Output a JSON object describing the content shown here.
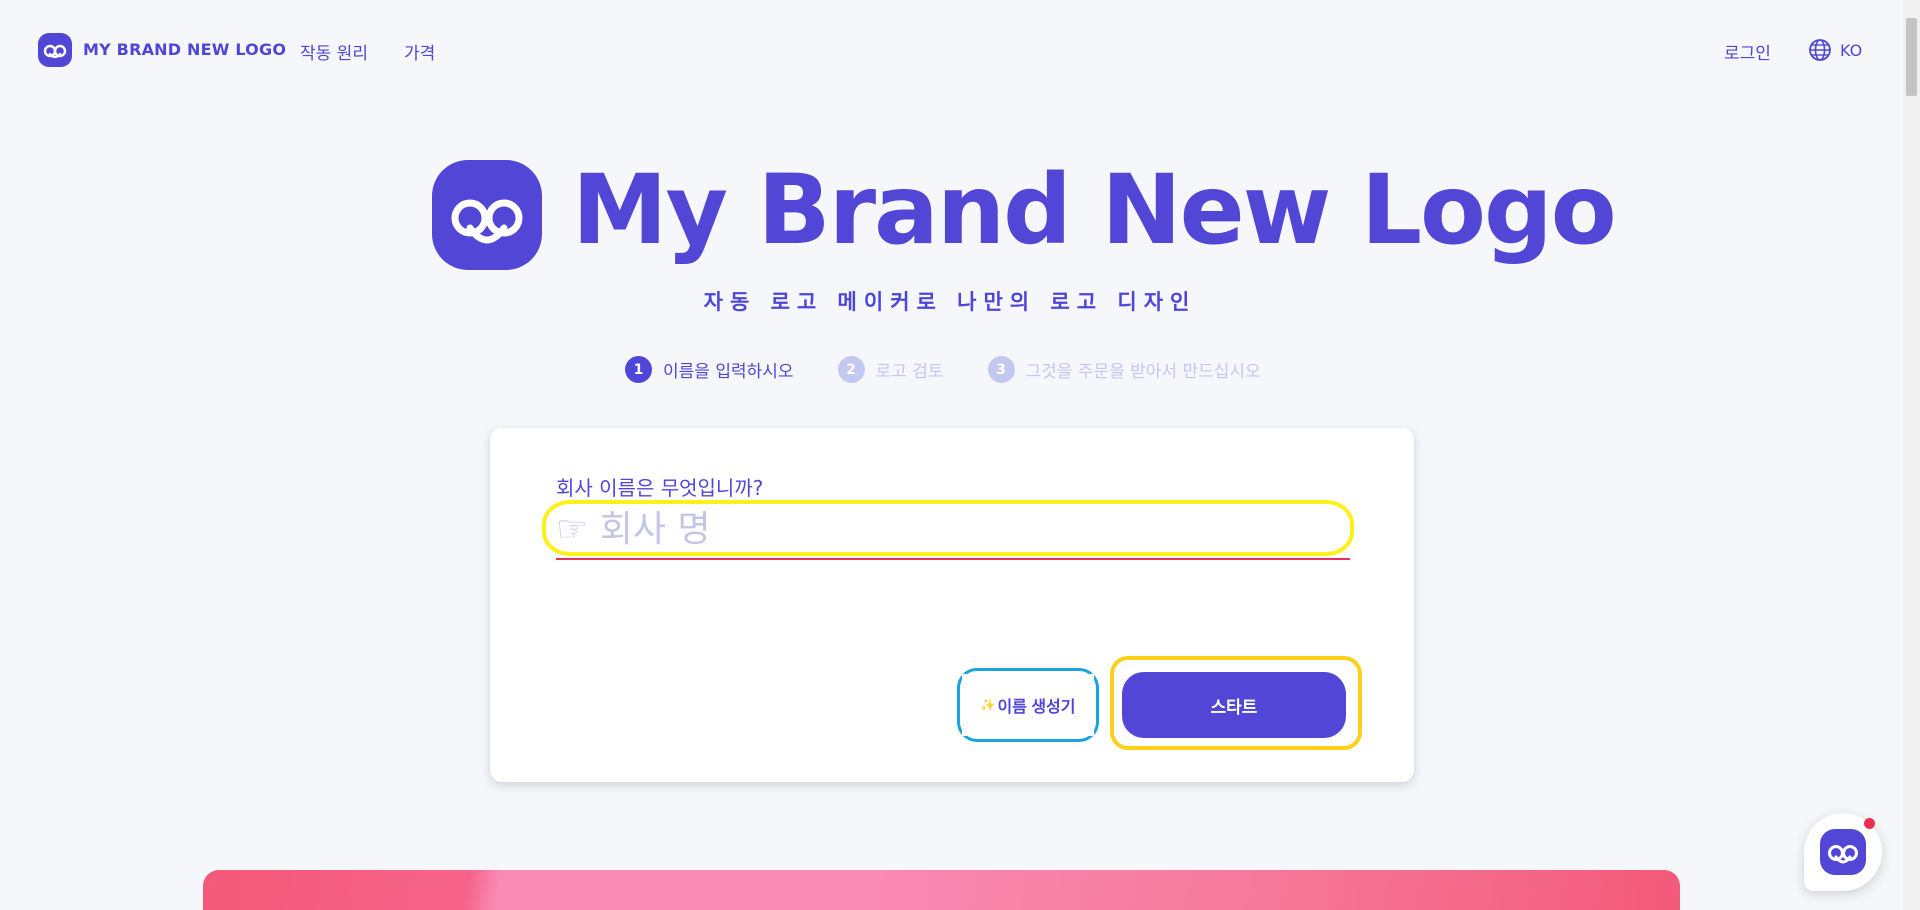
{
  "nav": {
    "brand": "MY BRAND NEW LOGO",
    "links": [
      "작동 원리",
      "가격"
    ],
    "login": "로그인",
    "language": "KO"
  },
  "hero": {
    "title": "My Brand New Logo",
    "subtitle": "자동 로고 메이커로 나만의 로고 디자인"
  },
  "steps": [
    {
      "num": "1",
      "label": "이름을 입력하시오",
      "state": "active"
    },
    {
      "num": "2",
      "label": "로고 검토",
      "state": "inactive"
    },
    {
      "num": "3",
      "label": "그것을 주문을 받아서 만드십시오",
      "state": "inactive"
    }
  ],
  "form": {
    "question": "회사 이름은 무엇입니까?",
    "input_placeholder": "☞ 회사 명",
    "input_value": "",
    "generator_label": "이름 생성기",
    "generator_icon": "✨",
    "start_label": "스타트"
  },
  "colors": {
    "brand": "#5146d6",
    "highlight_yellow": "#ffef1a",
    "highlight_blue": "#1aa3e0",
    "underline_red": "#e8305a"
  }
}
